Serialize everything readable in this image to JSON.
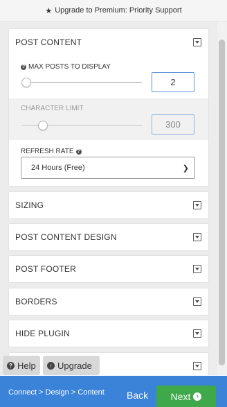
{
  "topbar": {
    "text": "Upgrade to Premium: Priority Support",
    "icon": "star-icon"
  },
  "post_content": {
    "title": "POST CONTENT",
    "max_posts": {
      "label": "MAX POSTS TO DISPLAY",
      "value": "2"
    },
    "char_limit": {
      "label": "CHARACTER LIMIT",
      "value": "300"
    },
    "refresh_rate": {
      "label": "REFRESH RATE",
      "selected": "24 Hours (Free)"
    }
  },
  "sections": [
    {
      "title": "SIZING"
    },
    {
      "title": "POST CONTENT DESIGN"
    },
    {
      "title": "POST FOOTER"
    },
    {
      "title": "BORDERS"
    },
    {
      "title": "HIDE PLUGIN"
    }
  ],
  "floating": {
    "help": "Help",
    "upgrade": "Upgrade"
  },
  "footer": {
    "breadcrumb": "Connect > Design > Content",
    "back": "Back",
    "next": "Next"
  },
  "colors": {
    "footer": "#3a83d8",
    "next_button": "#3ea84a",
    "input_border": "#5b8fd3"
  }
}
